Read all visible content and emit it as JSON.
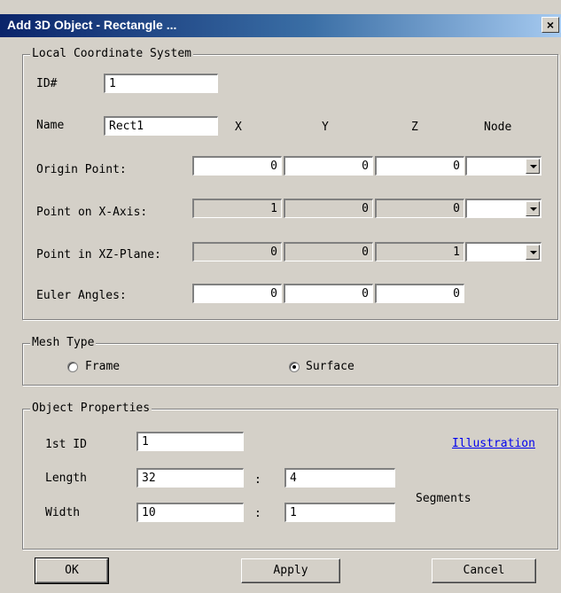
{
  "window": {
    "title": "Add 3D Object - Rectangle ...",
    "close_label": "×"
  },
  "lcs": {
    "legend": "Local Coordinate System",
    "id_label": "ID#",
    "id_value": "1",
    "name_label": "Name",
    "name_value": "Rect1",
    "columns": {
      "x": "X",
      "y": "Y",
      "z": "Z",
      "node": "Node"
    },
    "origin": {
      "label": "Origin Point:",
      "x": "0",
      "y": "0",
      "z": "0"
    },
    "x_axis": {
      "label": "Point on X-Axis:",
      "x": "1",
      "y": "0",
      "z": "0"
    },
    "xz_plane": {
      "label": "Point in XZ-Plane:",
      "x": "0",
      "y": "0",
      "z": "1"
    },
    "euler": {
      "label": "Euler Angles:",
      "x": "0",
      "y": "0",
      "z": "0"
    }
  },
  "mesh": {
    "legend": "Mesh Type",
    "frame_label": "Frame",
    "surface_label": "Surface",
    "selected": "Surface"
  },
  "props": {
    "legend": "Object Properties",
    "first_id_label": "1st ID",
    "first_id_value": "1",
    "illustration_label": "Illustration",
    "length_label": "Length",
    "length_value": "32",
    "length_segments": "4",
    "width_label": "Width",
    "width_value": "10",
    "width_segments": "1",
    "separator": ":",
    "segments_label": "Segments"
  },
  "buttons": {
    "ok": "OK",
    "apply": "Apply",
    "cancel": "Cancel"
  }
}
